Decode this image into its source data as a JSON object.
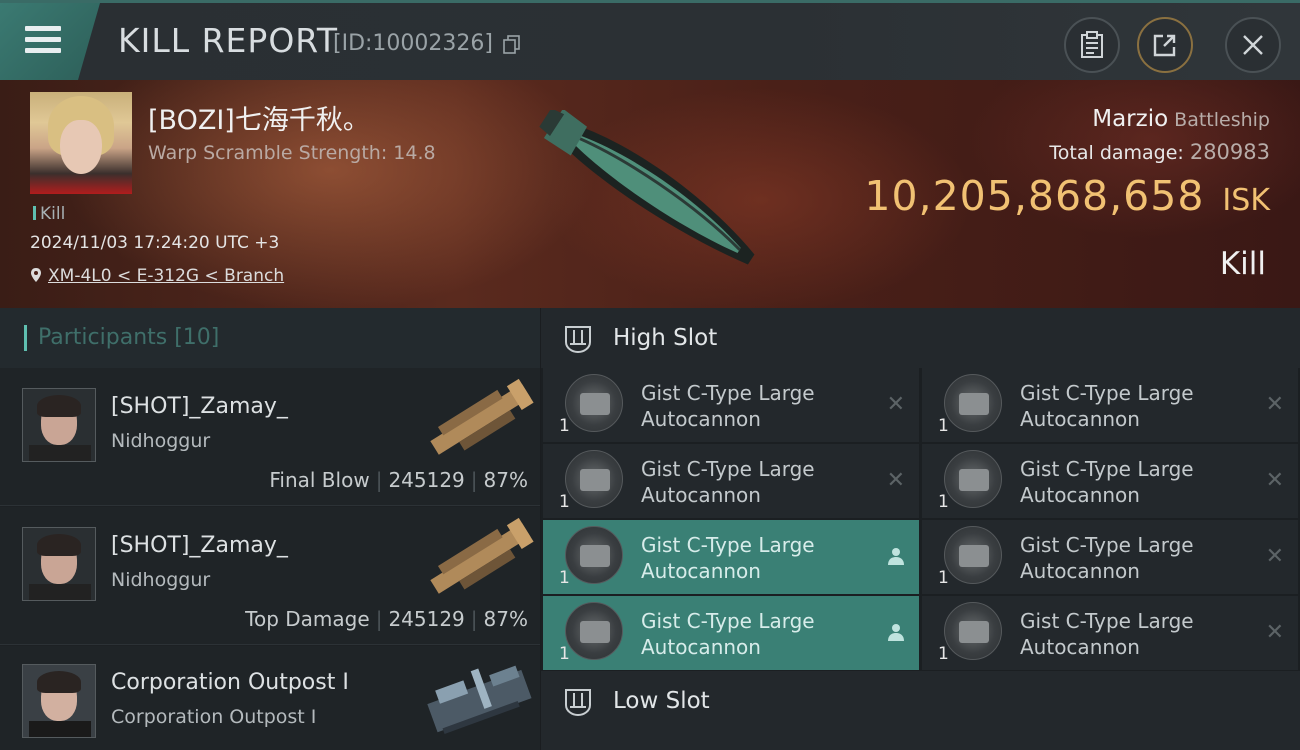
{
  "header": {
    "title": "KILL REPORT",
    "kill_id": "[ID:10002326]"
  },
  "victim": {
    "name": "[BOZI]七海千秋。",
    "scramble": "Warp Scramble Strength: 14.8",
    "kill_label": "Kill",
    "datetime": "2024/11/03 17:24:20 UTC +3",
    "location": "XM-4L0 < E-312G < Branch",
    "ship_name": "Marzio",
    "ship_class": "Battleship",
    "total_damage_label": "Total damage:",
    "total_damage": "280983",
    "isk_value": "10,205,868,658",
    "isk_currency": "ISK",
    "result": "Kill"
  },
  "participants": {
    "label": "Participants [10]",
    "rows": [
      {
        "name": "[SHOT]_Zamay_",
        "ship": "Nidhoggur",
        "role": "Final Blow",
        "damage": "245129",
        "percent": "87%"
      },
      {
        "name": "[SHOT]_Zamay_",
        "ship": "Nidhoggur",
        "role": "Top Damage",
        "damage": "245129",
        "percent": "87%"
      },
      {
        "name": "Corporation Outpost I",
        "ship": "Corporation Outpost I"
      }
    ]
  },
  "slots": {
    "high_label": "High Slot",
    "low_label": "Low Slot",
    "high_modules": [
      {
        "name": "Gist C-Type Large Autocannon",
        "qty": "1",
        "state": "destroyed"
      },
      {
        "name": "Gist C-Type Large Autocannon",
        "qty": "1",
        "state": "destroyed"
      },
      {
        "name": "Gist C-Type Large Autocannon",
        "qty": "1",
        "state": "destroyed"
      },
      {
        "name": "Gist C-Type Large Autocannon",
        "qty": "1",
        "state": "destroyed"
      },
      {
        "name": "Gist C-Type Large Autocannon",
        "qty": "1",
        "state": "dropped"
      },
      {
        "name": "Gist C-Type Large Autocannon",
        "qty": "1",
        "state": "destroyed"
      },
      {
        "name": "Gist C-Type Large Autocannon",
        "qty": "1",
        "state": "dropped"
      },
      {
        "name": "Gist C-Type Large Autocannon",
        "qty": "1",
        "state": "destroyed"
      }
    ]
  },
  "colors": {
    "accent": "#3a8075",
    "isk": "#f1c173",
    "header_bg": "#2a2f33"
  }
}
